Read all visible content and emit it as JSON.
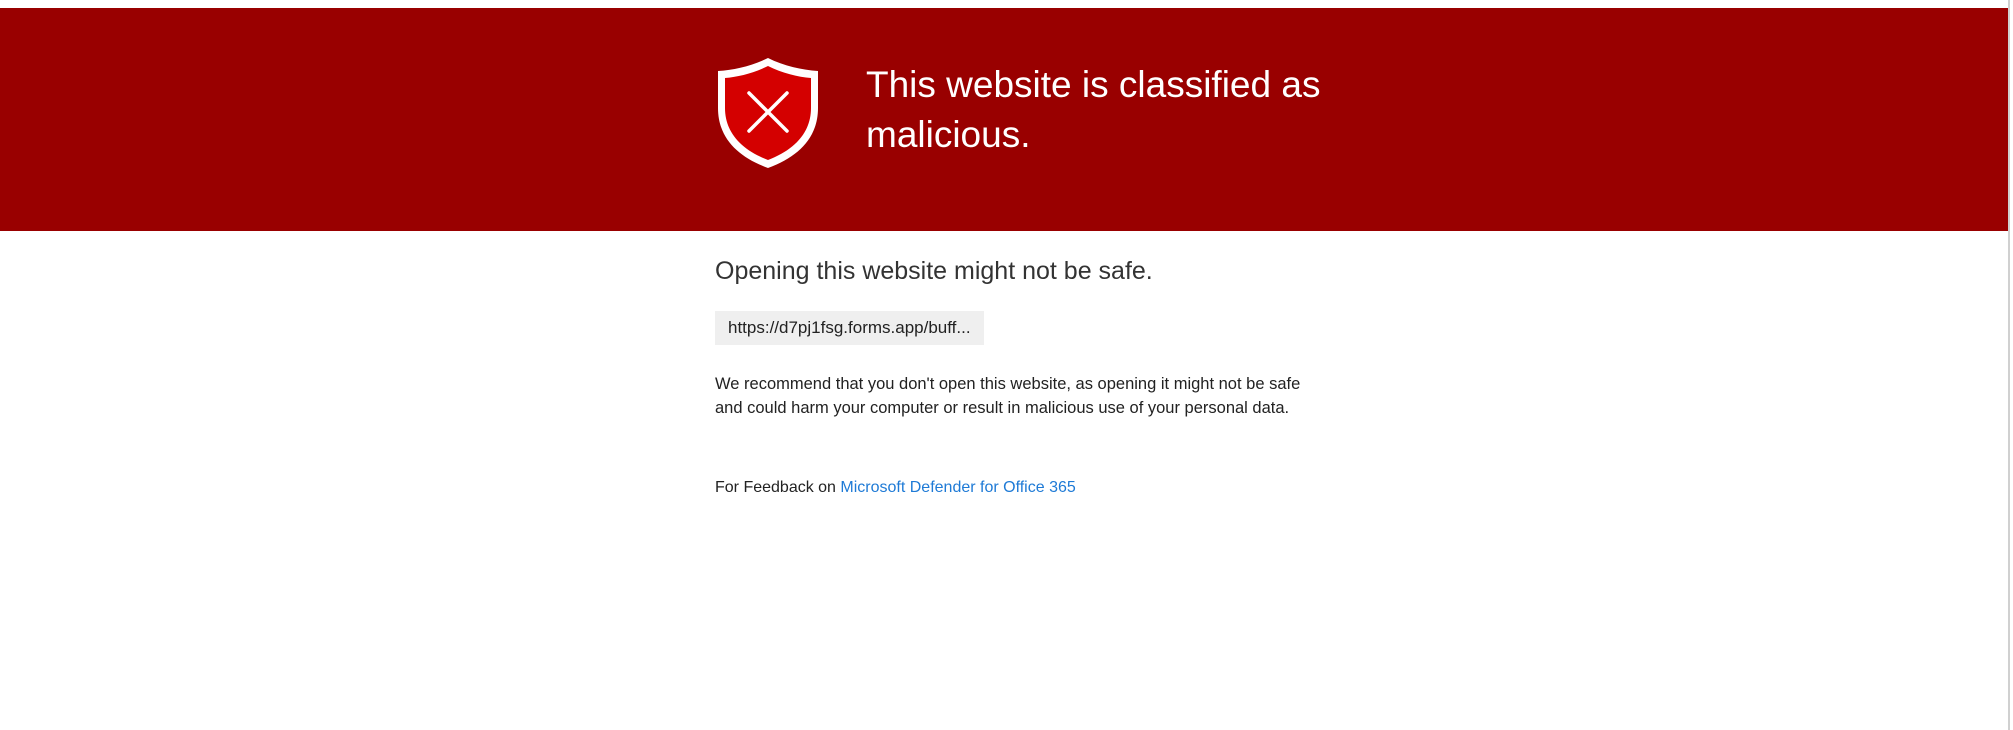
{
  "banner": {
    "title": "This website is classified as malicious.",
    "color": "#990000",
    "icon": "shield-x-icon"
  },
  "main": {
    "subtitle": "Opening this website might not be safe.",
    "url": "https://d7pj1fsg.forms.app/buff...",
    "recommendation": "We recommend that you don't open this website, as opening it might not be safe and could harm your computer or result in malicious use of your personal data.",
    "feedback_prefix": "For Feedback on ",
    "feedback_link": "Microsoft Defender for Office 365",
    "link_color": "#1e7ad6"
  }
}
